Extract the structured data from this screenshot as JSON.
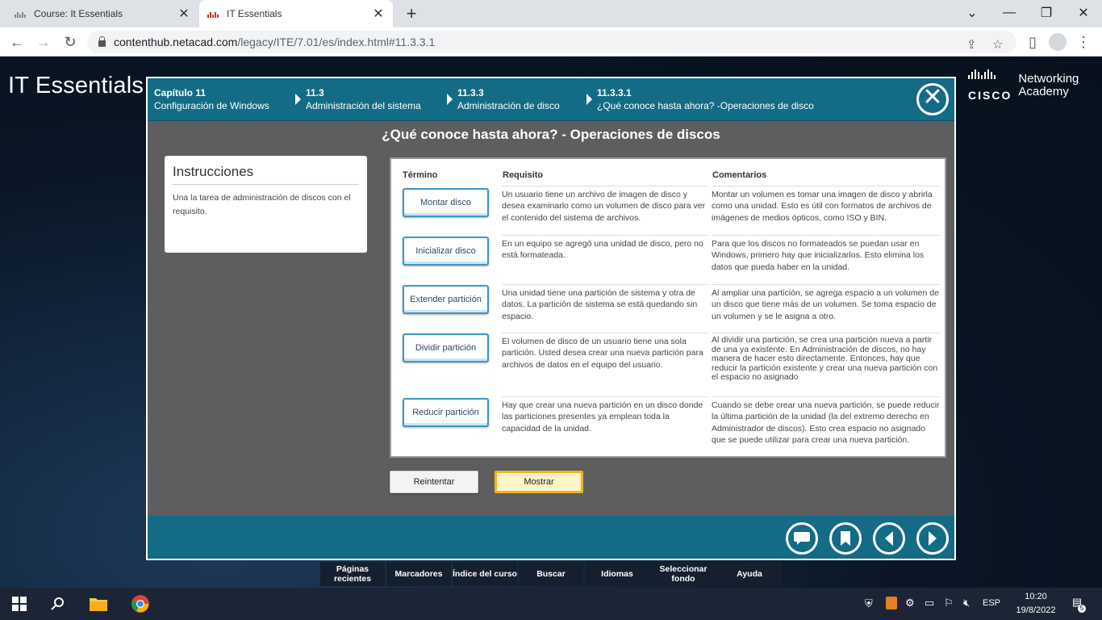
{
  "browser": {
    "tabs": [
      {
        "title": "Course: It Essentials",
        "active": false
      },
      {
        "title": "IT Essentials",
        "active": true
      }
    ],
    "url_host": "contenthub.netacad.com",
    "url_path": "/legacy/ITE/7.01/es/index.html#11.3.3.1"
  },
  "site": {
    "title": "IT Essentials",
    "logo_word": "CISCO",
    "logo_line1": "Networking",
    "logo_line2": "Academy"
  },
  "breadcrumbs": [
    {
      "num": "Capítulo 11",
      "label": "Configuración de Windows"
    },
    {
      "num": "11.3",
      "label": "Administración del sistema"
    },
    {
      "num": "11.3.3",
      "label": "Administración de disco"
    },
    {
      "num": "11.3.3.1",
      "label": "¿Qué conoce hasta ahora? -Operaciones de disco"
    }
  ],
  "page_title": "¿Qué conoce hasta ahora? - Operaciones de discos",
  "instructions": {
    "heading": "Instrucciones",
    "text": "Una la tarea de administración de discos con el requisito."
  },
  "table": {
    "headers": {
      "term": "Término",
      "req": "Requisito",
      "com": "Comentarios"
    },
    "rows": [
      {
        "term": "Montar disco",
        "req": "Un usuario tiene un archivo de imagen de disco y desea examinarlo como un volumen de disco para ver el contenido del sistema de archivos.",
        "com": "Montar un volumen es tomar una imagen de disco y abrirla como una unidad. Esto es útil con formatos de archivos de imágenes de medios ópticos, como ISO y BIN."
      },
      {
        "term": "Inicializar disco",
        "req": "En un equipo se agregó una unidad de disco, pero no está formateada.",
        "com": "Para que los discos no formateados se puedan usar en Windows, primero hay que inicializarlos. Esto elimina los datos que pueda haber en la unidad."
      },
      {
        "term": "Extender partición",
        "req": "Una unidad tiene una partición de sistema y otra de datos. La partición de sistema se está quedando sin espacio.",
        "com": "Al ampliar una partición, se agrega espacio a un volumen de un disco que tiene más de un volumen. Se toma espacio de un volumen y se le asigna a otro."
      },
      {
        "term": "Dividir partición",
        "req": "El volumen de disco de un usuario tiene una sola partición. Usted desea crear una nueva partición para archivos de datos en el equipo del usuario.",
        "com": "Al dividir una partición, se crea una partición nueva a partir de una ya existente. En Administración de discos, no hay manera de hacer esto directamente. Entonces, hay que reducir la partición existente y crear una nueva partición con el espacio no asignado"
      },
      {
        "term": "Reducir partición",
        "req": "Hay que crear una nueva partición en un disco donde las particiones presentes ya emplean toda la capacidad de la unidad.",
        "com": "Cuando se debe crear una nueva partición, se puede reducir la última partición de la unidad (la del extremo derecho en Administrador de discos). Esto crea espacio no asignado que se puede utilizar para crear una nueva partición."
      }
    ]
  },
  "actions": {
    "retry": "Reintentar",
    "show": "Mostrar"
  },
  "global_menu": [
    "Páginas recientes",
    "Marcadores",
    "Índice del curso",
    "Buscar",
    "Idiomas",
    "Seleccionar fondo",
    "Ayuda"
  ],
  "taskbar": {
    "lang": "ESP",
    "time": "10:20",
    "date": "19/8/2022",
    "notifications": "5"
  },
  "icons": {
    "bottom_nav": [
      "chat-icon",
      "bookmark-icon",
      "prev-icon",
      "next-icon"
    ]
  }
}
